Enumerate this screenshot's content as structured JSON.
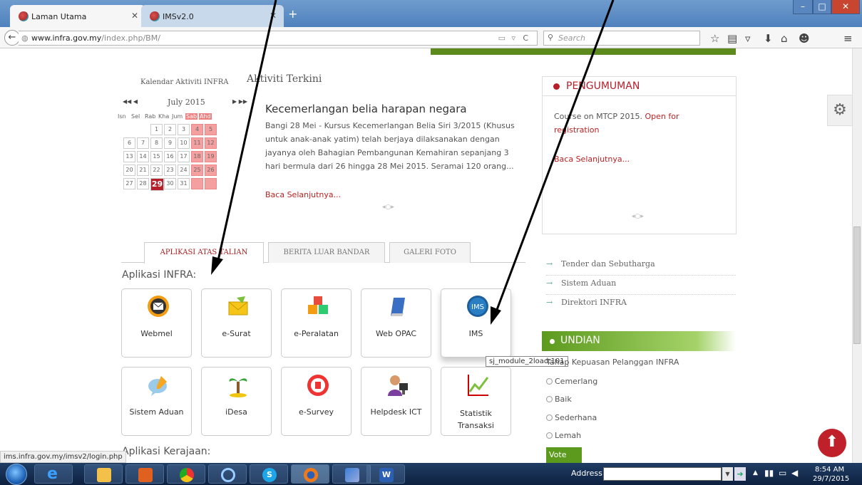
{
  "browser": {
    "tabs": [
      {
        "label": "Laman Utama",
        "active": true
      },
      {
        "label": "IMSv2.0",
        "active": false
      }
    ],
    "url_host": "www.infra.gov.my",
    "url_path": "/index.php/BM/",
    "search_placeholder": "Search",
    "status_url": "ims.infra.gov.my/imsv2/login.php"
  },
  "calendar": {
    "title": "Kalendar Aktiviti INFRA",
    "month": "July 2015",
    "prev": "◀◀ ◀",
    "next": "▶ ▶▶",
    "weekdays": [
      "Isn",
      "Sel",
      "Rab",
      "Kha",
      "Jum",
      "Sab",
      "Ahd"
    ],
    "weeks": [
      [
        "",
        "",
        "1",
        "2",
        "3",
        "4",
        "5"
      ],
      [
        "6",
        "7",
        "8",
        "9",
        "10",
        "11",
        "12"
      ],
      [
        "13",
        "14",
        "15",
        "16",
        "17",
        "18",
        "19"
      ],
      [
        "20",
        "21",
        "22",
        "23",
        "24",
        "25",
        "26"
      ],
      [
        "27",
        "28",
        "29",
        "30",
        "31",
        "",
        ""
      ]
    ],
    "today": "29"
  },
  "news": {
    "section_title": "Aktiviti Terkini",
    "headline": "Kecemerlangan belia harapan negara",
    "body": "Bangi 28 Mei - Kursus Kecemerlangan Belia Siri 3/2015 (Khusus untuk anak-anak yatim) telah berjaya dilaksanakan dengan jayanya oleh Bahagian Pembangunan Kemahiran sepanjang 3 hari bermula dari 26 hingga 28 Mei 2015. Seramai 120 orang...",
    "read_more": "Baca Selanjutnya..."
  },
  "announcement": {
    "title": "PENGUMUMAN",
    "text": "Course on MTCP 2015.",
    "link": "Open for registration",
    "read_more": "Baca Selanjutnya..."
  },
  "tabs": [
    {
      "label": "APLIKASI ATAS TALIAN"
    },
    {
      "label": "BERITA LUAR BANDAR"
    },
    {
      "label": "GALERI FOTO"
    }
  ],
  "apps_heading": "Aplikasi INFRA:",
  "apps": [
    {
      "label": "Webmel",
      "icon": "webmail-icon"
    },
    {
      "label": "e-Surat",
      "icon": "envelope-icon"
    },
    {
      "label": "e-Peralatan",
      "icon": "boxes-icon"
    },
    {
      "label": "Web OPAC",
      "icon": "book-icon"
    },
    {
      "label": "IMS",
      "icon": "ims-globe-icon"
    },
    {
      "label": "Sistem Aduan",
      "icon": "chat-pencil-icon"
    },
    {
      "label": "iDesa",
      "icon": "palm-tree-icon"
    },
    {
      "label": "e-Survey",
      "icon": "survey-icon"
    },
    {
      "label": "Helpdesk ICT",
      "icon": "helpdesk-agent-icon"
    },
    {
      "label": "Statistik Transaksi",
      "icon": "chart-icon"
    }
  ],
  "tooltip": "sj_module_2load:101",
  "gov_apps_heading": "Aplikasi Kerajaan:",
  "side_links": [
    "Tender dan Sebutharga",
    "Sistem Aduan",
    "Direktori INFRA"
  ],
  "poll": {
    "title": "UNDIAN",
    "question": "Tahap Kepuasan Pelanggan INFRA",
    "options": [
      "Cemerlang",
      "Baik",
      "Sederhana",
      "Lemah"
    ],
    "vote_label": "Vote"
  },
  "taskbar": {
    "address_label": "Address",
    "time": "8:54 AM",
    "date": "29/7/2015"
  }
}
